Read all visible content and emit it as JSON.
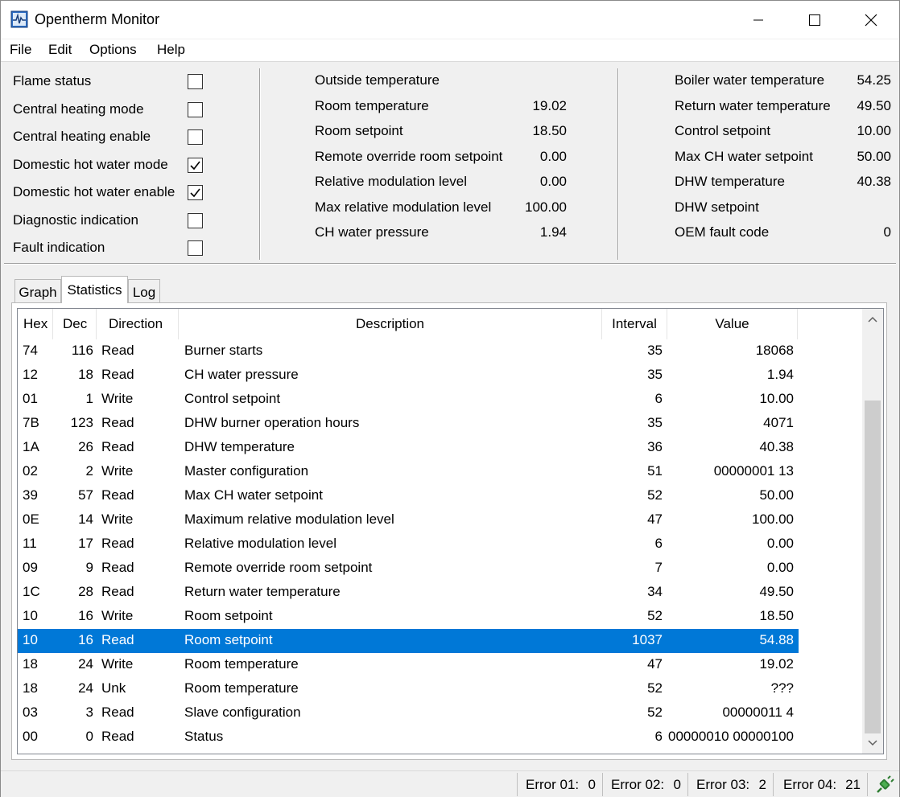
{
  "window": {
    "title": "Opentherm Monitor"
  },
  "menu": [
    "File",
    "Edit",
    "Options",
    "Help"
  ],
  "flags": [
    {
      "label": "Flame status",
      "checked": false
    },
    {
      "label": "Central heating mode",
      "checked": false
    },
    {
      "label": "Central heating enable",
      "checked": false
    },
    {
      "label": "Domestic hot water mode",
      "checked": true
    },
    {
      "label": "Domestic hot water enable",
      "checked": true
    },
    {
      "label": "Diagnostic indication",
      "checked": false
    },
    {
      "label": "Fault indication",
      "checked": false
    }
  ],
  "middle_params": [
    {
      "label": "Outside temperature",
      "value": ""
    },
    {
      "label": "Room temperature",
      "value": "19.02"
    },
    {
      "label": "Room setpoint",
      "value": "18.50"
    },
    {
      "label": "Remote override room setpoint",
      "value": "0.00"
    },
    {
      "label": "Relative modulation level",
      "value": "0.00"
    },
    {
      "label": "Max relative modulation level",
      "value": "100.00"
    },
    {
      "label": "CH water pressure",
      "value": "1.94"
    }
  ],
  "right_params": [
    {
      "label": "Boiler water temperature",
      "value": "54.25"
    },
    {
      "label": "Return water temperature",
      "value": "49.50"
    },
    {
      "label": "Control setpoint",
      "value": "10.00"
    },
    {
      "label": "Max CH water setpoint",
      "value": "50.00"
    },
    {
      "label": "DHW temperature",
      "value": "40.38"
    },
    {
      "label": "DHW setpoint",
      "value": ""
    },
    {
      "label": "OEM fault code",
      "value": "0"
    }
  ],
  "tabs": [
    {
      "label": "Graph",
      "active": false
    },
    {
      "label": "Statistics",
      "active": true
    },
    {
      "label": "Log",
      "active": false
    }
  ],
  "table": {
    "columns": [
      "Hex",
      "Dec",
      "Direction",
      "Description",
      "Interval",
      "Value"
    ],
    "rows": [
      [
        "74",
        "116",
        "Read",
        "Burner starts",
        "35",
        "18068"
      ],
      [
        "12",
        "18",
        "Read",
        "CH water pressure",
        "35",
        "1.94"
      ],
      [
        "01",
        "1",
        "Write",
        "Control setpoint",
        "6",
        "10.00"
      ],
      [
        "7B",
        "123",
        "Read",
        "DHW burner operation hours",
        "35",
        "4071"
      ],
      [
        "1A",
        "26",
        "Read",
        "DHW temperature",
        "36",
        "40.38"
      ],
      [
        "02",
        "2",
        "Write",
        "Master configuration",
        "51",
        "00000001 13"
      ],
      [
        "39",
        "57",
        "Read",
        "Max CH water setpoint",
        "52",
        "50.00"
      ],
      [
        "0E",
        "14",
        "Write",
        "Maximum relative modulation level",
        "47",
        "100.00"
      ],
      [
        "11",
        "17",
        "Read",
        "Relative modulation level",
        "6",
        "0.00"
      ],
      [
        "09",
        "9",
        "Read",
        "Remote override room setpoint",
        "7",
        "0.00"
      ],
      [
        "1C",
        "28",
        "Read",
        "Return water temperature",
        "34",
        "49.50"
      ],
      [
        "10",
        "16",
        "Write",
        "Room setpoint",
        "52",
        "18.50"
      ],
      [
        "10",
        "16",
        "Read",
        "Room setpoint",
        "1037",
        "54.88"
      ],
      [
        "18",
        "24",
        "Write",
        "Room temperature",
        "47",
        "19.02"
      ],
      [
        "18",
        "24",
        "Unk",
        "Room temperature",
        "52",
        "???"
      ],
      [
        "03",
        "3",
        "Read",
        "Slave configuration",
        "52",
        "00000011 4"
      ],
      [
        "00",
        "0",
        "Read",
        "Status",
        "6",
        "00000010 00000100"
      ]
    ],
    "selected_row": 12
  },
  "status_bar": [
    {
      "label": "Error 01:",
      "value": "0"
    },
    {
      "label": "Error 02:",
      "value": "0"
    },
    {
      "label": "Error 03:",
      "value": "2"
    },
    {
      "label": "Error 04:",
      "value": "21"
    }
  ],
  "colors": {
    "selection": "#0078d7",
    "connected_icon": "#3a9d3a"
  }
}
